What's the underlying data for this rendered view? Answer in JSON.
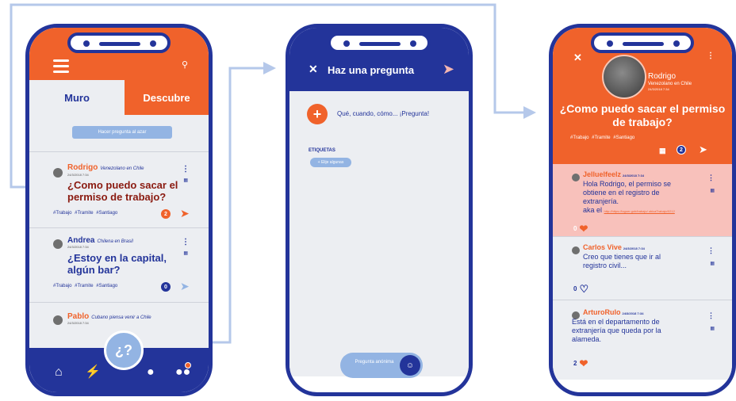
{
  "colors": {
    "orange": "#f0622b",
    "navy": "#23349a",
    "light_blue": "#93b4e3",
    "bg_gray": "#eceef2",
    "pink": "#f8c1bb"
  },
  "screen1": {
    "tabs": [
      "Muro",
      "Descubre"
    ],
    "random_button": "Hacer pregunta al azar",
    "posts": [
      {
        "name": "Rodrigo",
        "subtitle": "Venezolano en Chile",
        "date": "24/3/2018 7:34",
        "title": "¿Como puedo sacar el permiso de trabajo?",
        "tags": "#Trabajo  #Tramite  #Santiago",
        "answers": "2"
      },
      {
        "name": "Andrea",
        "subtitle": "Chilena en Brasil",
        "date": "24/3/2018 7:34",
        "title": "¿Estoy en la capital, algún bar?",
        "tags": "#Trabajo  #Tramite  #Santiago",
        "answers": "0"
      },
      {
        "name": "Pablo",
        "subtitle": "Cubano piensa venir a Chile",
        "date": "24/3/2018 7:34"
      }
    ],
    "ask_button": "¿?"
  },
  "screen2": {
    "title": "Haz una pregunta",
    "placeholder": "Qué, cuando, cómo... ¡Pregunta!",
    "tags_label": "ETIQUETAS",
    "chip": "+ Elije algunas",
    "anon_label": "Pregunta anónima"
  },
  "screen3": {
    "author": "Rodrigo",
    "author_sub": "Venezolano en Chile",
    "date": "24/3/2018 7:34",
    "title": "¿Como puedo sacar el permiso de trabajo?",
    "tags": "#Trabajo  #Tramite  #Santiago",
    "answers_count": "2",
    "answers": [
      {
        "name": "Jelluelfeelz",
        "date": "24/3/2018 7:34",
        "text": "Hola Rodrigo, el permiso se obtiene en el registro de extranjería.",
        "text2": "aka el",
        "link": "http://https://loguer.gob/trabajo/ ubicaTrabajo/0212",
        "likes": "0"
      },
      {
        "name": "Carlos Vive",
        "date": "24/3/2018 7:34",
        "text": "Creo que tienes que ir al registro civil...",
        "likes": "0"
      },
      {
        "name": "ArturoRulo",
        "date": "24/3/2018 7:34",
        "text": "Está en el departamento de extranjería que queda por la alameda.",
        "likes": "2"
      }
    ]
  },
  "icons": [
    "menu-icon",
    "search-icon",
    "send-icon",
    "translate-icon",
    "kebab-icon",
    "home-icon",
    "bolt-icon",
    "user-icon",
    "group-icon",
    "close-icon",
    "plus-icon",
    "mask-icon",
    "heart-icon"
  ]
}
